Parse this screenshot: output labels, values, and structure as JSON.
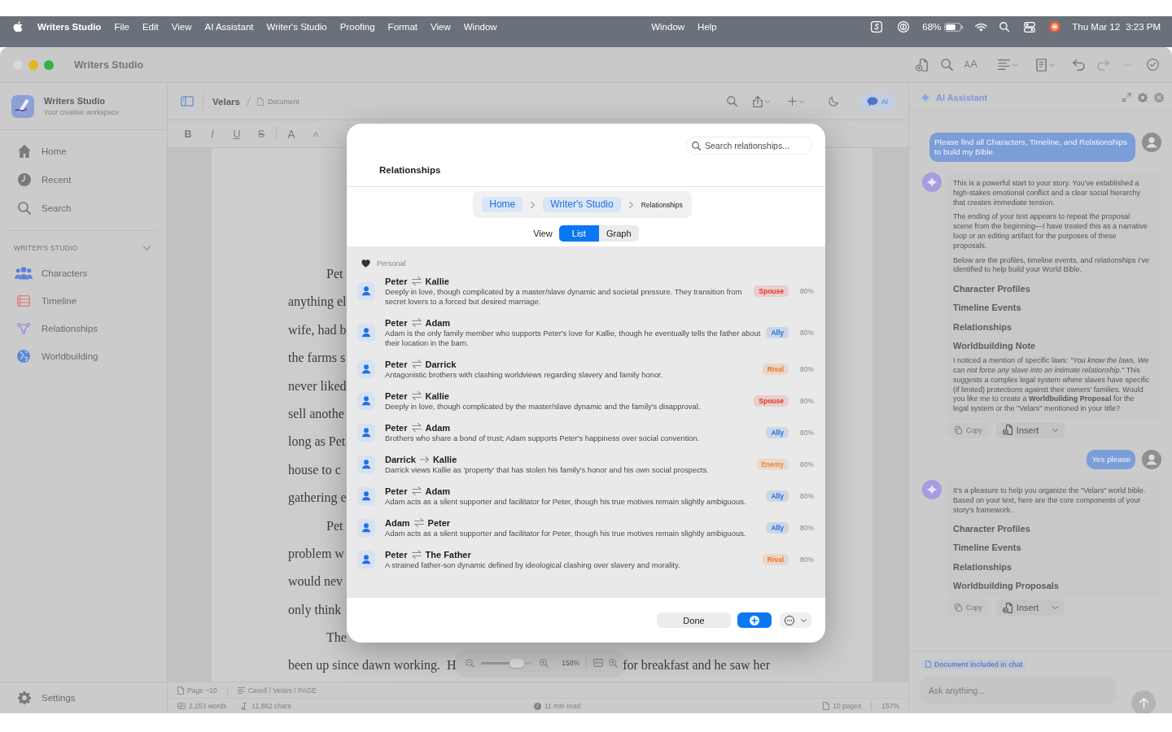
{
  "menu_bar": {
    "app_name": "Writers Studio",
    "menus": [
      "File",
      "Edit",
      "View",
      "AI Assistant",
      "Writer's Studio",
      "Proofing",
      "Format",
      "View",
      "Window"
    ],
    "center_menus": [
      "Window",
      "Help"
    ],
    "battery": "68%",
    "date": "Thu Mar 12",
    "time": "3:23 PM"
  },
  "window": {
    "title": "Writers Studio",
    "text_size_glyphs": [
      "A",
      "A"
    ]
  },
  "sidebar": {
    "app_name": "Writers Studio",
    "tagline": "Your creative workspace",
    "nav": [
      {
        "label": "Home",
        "selected": false
      },
      {
        "label": "Recent",
        "selected": false
      },
      {
        "label": "Search",
        "selected": false
      }
    ],
    "section": {
      "title": "WRITER'S STUDIO",
      "expanded": true,
      "items": [
        "Characters",
        "Timeline",
        "Relationships",
        "Worldbuilding"
      ]
    },
    "settings": "Settings"
  },
  "editor": {
    "document": "Velars",
    "crumb": "Document",
    "ai_toggle": "AI",
    "format_buttons": [
      {
        "label": "B",
        "kind": "bold"
      },
      {
        "label": "I",
        "kind": "italic"
      },
      {
        "label": "U",
        "kind": "underline"
      },
      {
        "label": "S",
        "kind": "strike"
      },
      {
        "label": "A",
        "kind": "larger"
      },
      {
        "label": "A",
        "kind": "smaller"
      }
    ],
    "page_lines": [
      {
        "text": "Pet",
        "indent": true
      },
      {
        "text": "anything el",
        "indent": false
      },
      {
        "text": "wife, had b",
        "indent": false
      },
      {
        "text": "the farms s",
        "indent": false
      },
      {
        "text": "never liked",
        "indent": false
      },
      {
        "text": "sell anothe",
        "indent": false
      },
      {
        "text": "long as Pet",
        "indent": false
      },
      {
        "text": "house to c",
        "indent": false
      },
      {
        "text": "gathering e",
        "indent": false
      },
      {
        "text": "Pet",
        "indent": true
      },
      {
        "text": "problem w",
        "indent": false
      },
      {
        "text": "would nev",
        "indent": false
      },
      {
        "text": "only think",
        "indent": false
      },
      {
        "text": "The",
        "indent": true
      },
      {
        "text": "been up since dawn working.  H",
        "after": "for breakfast and he saw her",
        "indent": false
      }
    ],
    "zoom": {
      "level": 0.69,
      "reading": "158%"
    },
    "status": {
      "page": "Page ~10",
      "path": "Cavell / Velars / PAGE",
      "words": "2,253 words",
      "chars": "11,862 chars",
      "read_time": "11 min read",
      "pages": "10 pages",
      "zoom": "157%"
    }
  },
  "ai_panel": {
    "title": "AI Assistant",
    "messages": [
      {
        "kind": "user",
        "text": "Please find all Characters, Timeline, and Relationships to build my Bible"
      },
      {
        "kind": "assistant",
        "blocks": [
          {
            "kind": "paragraph",
            "text": "This is a powerful start to your story. You’ve established a high-stakes emotional conflict and a clear social hierarchy that creates immediate tension."
          },
          {
            "kind": "paragraph",
            "text": "The ending of your text appears to repeat the proposal scene from the beginning—I have treated this as a narrative loop or an editing artifact for the purposes of these proposals."
          },
          {
            "kind": "paragraph",
            "text": "Below are the profiles, timeline events, and relationships I’ve identified to help build your World Bible."
          },
          {
            "kind": "heading",
            "text": "Character Profiles"
          },
          {
            "kind": "heading",
            "text": "Timeline Events"
          },
          {
            "kind": "heading",
            "text": "Relationships"
          },
          {
            "kind": "heading",
            "text": "Worldbuilding Note"
          },
          {
            "kind": "paragraph",
            "text": "I noticed a mention of specific laws: *\"You know the laws, We can not force any slave into an intimate relationship.\"* This suggests a complex legal system where slaves have specific (if limited) protections against their owners' families. Would you like me to create a **Worldbuilding Proposal** for the legal system or the \"Velars\" mentioned in your title?"
          }
        ],
        "actions": [
          {
            "label": "Copy",
            "kind": "copy",
            "disabled": true
          },
          {
            "label": "Insert",
            "kind": "insert",
            "disabled": false
          }
        ]
      },
      {
        "kind": "user",
        "text": "Yes please"
      },
      {
        "kind": "assistant",
        "blocks": [
          {
            "kind": "paragraph",
            "text": "It’s a pleasure to help you organize the \"Velars\" world bible. Based on your text, here are the core components of your story's framework."
          },
          {
            "kind": "heading",
            "text": "Character Profiles"
          },
          {
            "kind": "heading",
            "text": "Timeline Events"
          },
          {
            "kind": "heading",
            "text": "Relationships"
          },
          {
            "kind": "heading",
            "text": "Worldbuilding Proposals"
          }
        ],
        "actions": [
          {
            "label": "Copy",
            "kind": "copy",
            "disabled": true
          },
          {
            "label": "Insert",
            "kind": "insert",
            "disabled": false
          }
        ]
      }
    ],
    "context_chip": "Document included in chat",
    "input_placeholder": "Ask anything..."
  },
  "relationships_dialog": {
    "search_placeholder": "Search relationships...",
    "title": "Relationships",
    "breadcrumb": [
      {
        "label": "Home",
        "kind": "link"
      },
      {
        "label": "Writer's Studio",
        "kind": "link"
      },
      {
        "label": "Relationships",
        "kind": "current"
      }
    ],
    "view_label": "View",
    "views": [
      {
        "label": "List",
        "selected": true
      },
      {
        "label": "Graph",
        "selected": false
      }
    ],
    "group": "Personal",
    "relationships": [
      {
        "from": "Peter",
        "to": "Kallie",
        "kind": "mutual",
        "description": "Deeply in love, though complicated by a master/slave dynamic and societal pressure. They transition from secret lovers to a forced but desired marriage.",
        "type": "Spouse",
        "color": "#e5352b",
        "strength": "80%"
      },
      {
        "from": "Peter",
        "to": "Adam",
        "kind": "mutual",
        "description": "Adam is the only family member who supports Peter's love for Kallie, though he eventually tells the father about their location in the barn.",
        "type": "Ally",
        "color": "#1f6fe0",
        "strength": "80%"
      },
      {
        "from": "Peter",
        "to": "Darrick",
        "kind": "mutual",
        "description": "Antagonistic brothers with clashing worldviews regarding slavery and family honor.",
        "type": "Rival",
        "color": "#ee7520",
        "strength": "80%"
      },
      {
        "from": "Peter",
        "to": "Kallie",
        "kind": "mutual",
        "description": "Deeply in love, though complicated by the master/slave dynamic and the family's disapproval.",
        "type": "Spouse",
        "color": "#e5352b",
        "strength": "80%"
      },
      {
        "from": "Peter",
        "to": "Adam",
        "kind": "mutual",
        "description": "Brothers who share a bond of trust; Adam supports Peter's happiness over social convention.",
        "type": "Ally",
        "color": "#1f6fe0",
        "strength": "80%"
      },
      {
        "from": "Darrick",
        "to": "Kallie",
        "kind": "directed",
        "description": "Darrick views Kallie as 'property' that has stolen his family's honor and his own social prospects.",
        "type": "Enemy",
        "color": "#f0832e",
        "strength": "80%"
      },
      {
        "from": "Peter",
        "to": "Adam",
        "kind": "mutual",
        "description": "Adam acts as a silent supporter and facilitator for Peter, though his true motives remain slightly ambiguous.",
        "type": "Ally",
        "color": "#1f6fe0",
        "strength": "80%"
      },
      {
        "from": "Adam",
        "to": "Peter",
        "kind": "mutual",
        "description": "Adam acts as a silent supporter and facilitator for Peter, though his true motives remain slightly ambiguous.",
        "type": "Ally",
        "color": "#1f6fe0",
        "strength": "80%"
      },
      {
        "from": "Peter",
        "to": "The Father",
        "kind": "mutual",
        "description": "A strained father-son dynamic defined by ideological clashing over slavery and morality.",
        "type": "Rival",
        "color": "#ee7520",
        "strength": "80%"
      }
    ],
    "done": "Done"
  }
}
